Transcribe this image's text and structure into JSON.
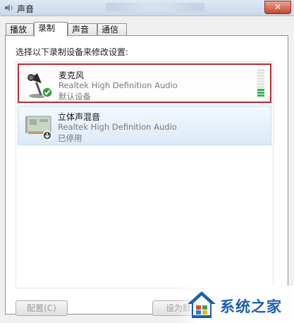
{
  "window": {
    "title": "声音",
    "close_glyph": "✕"
  },
  "tabs": [
    {
      "label": "播放",
      "active": false
    },
    {
      "label": "录制",
      "active": true
    },
    {
      "label": "声音",
      "active": false
    },
    {
      "label": "通信",
      "active": false
    }
  ],
  "instruction": "选择以下录制设备来修改设置:",
  "devices": [
    {
      "name": "麦克风",
      "driver": "Realtek High Definition Audio",
      "status": "默认设备",
      "icon": "microphone-icon",
      "badge": "check-icon",
      "selected": true
    },
    {
      "name": "立体声混音",
      "driver": "Realtek High Definition Audio",
      "status": "已停用",
      "icon": "sound-card-icon",
      "badge": "disabled-arrow-icon",
      "selected": false
    }
  ],
  "level_meter": {
    "level": 0.3,
    "segments": 10
  },
  "buttons": {
    "configure": "配置(C)",
    "set_default": "设为默"
  },
  "watermark": {
    "text": "系统之家"
  },
  "colors": {
    "selection_border": "#c0282e",
    "level_on": "#3cae55",
    "watermark_blue": "#1b5fae"
  }
}
